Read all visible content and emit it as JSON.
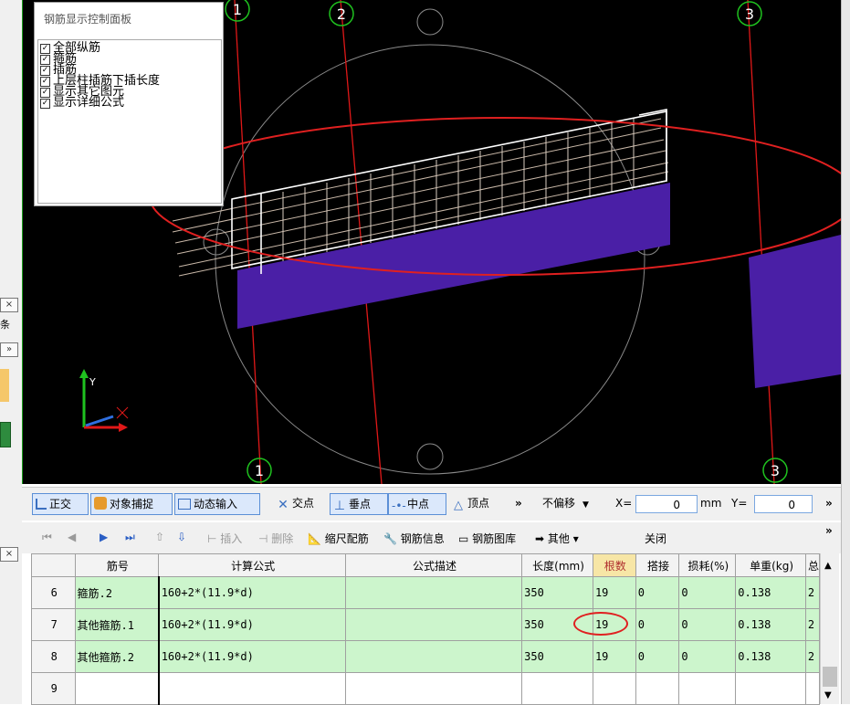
{
  "control_panel": {
    "title": "钢筋显示控制面板",
    "options": [
      {
        "label": "全部纵筋",
        "checked": true
      },
      {
        "label": "箍筋",
        "checked": true
      },
      {
        "label": "插筋",
        "checked": true
      },
      {
        "label": "上层柱插筋下插长度",
        "checked": true
      },
      {
        "label": "显示其它图元",
        "checked": true
      },
      {
        "label": "显示详细公式",
        "checked": true
      }
    ]
  },
  "axis_markers": {
    "top_left": "1",
    "top_mid": "2",
    "top_right": "3",
    "bottom_left": "1",
    "bottom_right": "3"
  },
  "snap_toolbar": {
    "ortho": "正交",
    "object_snap": "对象捕捉",
    "dynamic_input": "动态输入",
    "intersection": "交点",
    "perpendicular": "垂点",
    "midpoint": "中点",
    "vertex": "顶点",
    "more": "»",
    "offset_mode": "不偏移",
    "x_label": "X=",
    "x_value": "0",
    "unit_mm": "mm",
    "y_label": "Y=",
    "y_value": "0",
    "more2": "»"
  },
  "rebar_toolbar": {
    "insert": "插入",
    "delete": "删除",
    "scale_rebar": "缩尺配筋",
    "rebar_info": "钢筋信息",
    "rebar_library": "钢筋图库",
    "other": "其他",
    "close": "关闭",
    "more": "»"
  },
  "table": {
    "headers": [
      "筋号",
      "计算公式",
      "公式描述",
      "长度(mm)",
      "根数",
      "搭接",
      "损耗(%)",
      "单重(kg)",
      "总"
    ],
    "rows": [
      {
        "no": "6",
        "name": "箍筋.2",
        "formula": "160+2*(11.9*d)",
        "desc": "",
        "length": "350",
        "count": "19",
        "lap": "0",
        "loss": "0",
        "weight": "0.138",
        "total": "2"
      },
      {
        "no": "7",
        "name": "其他箍筋.1",
        "formula": "160+2*(11.9*d)",
        "desc": "",
        "length": "350",
        "count": "19",
        "lap": "0",
        "loss": "0",
        "weight": "0.138",
        "total": "2"
      },
      {
        "no": "8",
        "name": "其他箍筋.2",
        "formula": "160+2*(11.9*d)",
        "desc": "",
        "length": "350",
        "count": "19",
        "lap": "0",
        "loss": "0",
        "weight": "0.138",
        "total": "2"
      },
      {
        "no": "9",
        "name": "",
        "formula": "",
        "desc": "",
        "length": "",
        "count": "",
        "lap": "",
        "loss": "",
        "weight": "",
        "total": ""
      }
    ]
  },
  "left_strip": {
    "close_1": "×",
    "close_2": "×",
    "more": "»",
    "label_fragment": "条"
  },
  "colors": {
    "viewport_bg": "#000000",
    "beam": "#4a1fa6",
    "axis_line": "#e01818",
    "axis_bubble": "#1fc21f",
    "annotation": "#e02020",
    "row_green": "#ccf5cc"
  }
}
